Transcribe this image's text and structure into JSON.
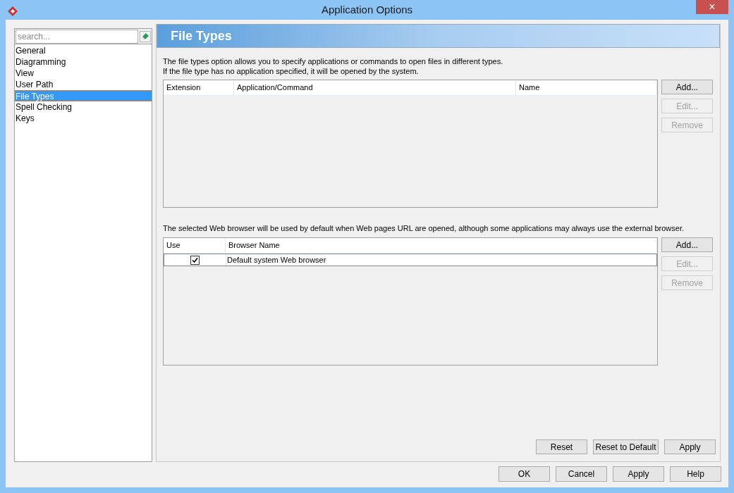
{
  "window": {
    "title": "Application Options",
    "close": "×"
  },
  "sidebar": {
    "search_placeholder": "search...",
    "items": [
      {
        "label": "General",
        "selected": false
      },
      {
        "label": "Diagramming",
        "selected": false
      },
      {
        "label": "View",
        "selected": false
      },
      {
        "label": "User Path",
        "selected": false
      },
      {
        "label": "File Types",
        "selected": true
      },
      {
        "label": "Spell Checking",
        "selected": false
      },
      {
        "label": "Keys",
        "selected": false
      }
    ]
  },
  "page": {
    "heading": "File Types",
    "description": [
      "The file types option allows you to specify applications or commands to open files in different types.",
      "If the file type has no application specified, it will be opened by the system."
    ],
    "file_types_table": {
      "columns": [
        "Extension",
        "Application/Command",
        "Name"
      ],
      "buttons": [
        {
          "label": "Add...",
          "disabled": false
        },
        {
          "label": "Edit...",
          "disabled": true
        },
        {
          "label": "Remove",
          "disabled": true
        }
      ]
    },
    "browser_note": "The selected Web browser will be used by default when Web pages URL are opened, although some applications may always use the external browser.",
    "browser_table": {
      "columns": [
        "Use",
        "Browser Name"
      ],
      "rows": [
        {
          "checked": true,
          "name": "Default system Web browser"
        }
      ],
      "buttons": [
        {
          "label": "Add...",
          "disabled": false
        },
        {
          "label": "Edit...",
          "disabled": true
        },
        {
          "label": "Remove",
          "disabled": true
        }
      ]
    },
    "panel_buttons": [
      "Reset",
      "Reset to Default",
      "Apply"
    ]
  },
  "footer_buttons": [
    "OK",
    "Cancel",
    "Apply",
    "Help"
  ]
}
